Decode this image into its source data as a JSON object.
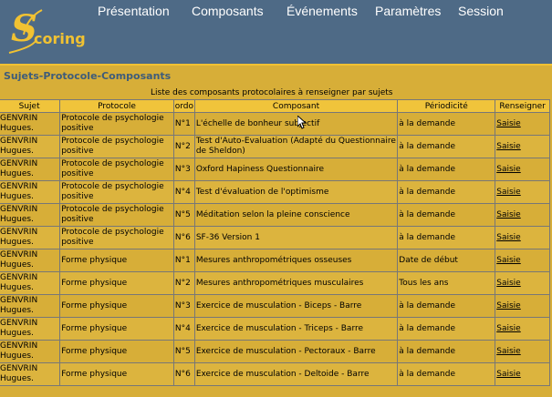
{
  "logo": {
    "initial": "S",
    "text": "coring"
  },
  "nav": [
    {
      "label": "Présentation"
    },
    {
      "label": "Composants"
    },
    {
      "label": "Événements"
    },
    {
      "label": "Paramètres"
    },
    {
      "label": "Session"
    }
  ],
  "page": {
    "title": "Sujets-Protocole-Composants",
    "caption": "Liste des composants protocolaires à renseigner par sujets"
  },
  "table": {
    "headers": [
      "Sujet",
      "Protocole",
      "ordo",
      "Composant",
      "Périodicité",
      "Renseigner"
    ],
    "rows": [
      {
        "sujet": "GENVRIN Hugues.",
        "protocole": "Protocole de psychologie positive",
        "ordo": "N°1",
        "composant": "L'échelle de bonheur subjectif",
        "periodicite": "à la demande",
        "action": "Saisie"
      },
      {
        "sujet": "GENVRIN Hugues.",
        "protocole": "Protocole de psychologie positive",
        "ordo": "N°2",
        "composant": "Test d'Auto-Evaluation (Adapté du Questionnaire de Sheldon)",
        "periodicite": "à la demande",
        "action": "Saisie"
      },
      {
        "sujet": "GENVRIN Hugues.",
        "protocole": "Protocole de psychologie positive",
        "ordo": "N°3",
        "composant": "Oxford Hapiness Questionnaire",
        "periodicite": "à la demande",
        "action": "Saisie"
      },
      {
        "sujet": "GENVRIN Hugues.",
        "protocole": "Protocole de psychologie positive",
        "ordo": "N°4",
        "composant": "Test d'évaluation de l'optimisme",
        "periodicite": "à la demande",
        "action": "Saisie"
      },
      {
        "sujet": "GENVRIN Hugues.",
        "protocole": "Protocole de psychologie positive",
        "ordo": "N°5",
        "composant": "Méditation selon la pleine conscience",
        "periodicite": "à la demande",
        "action": "Saisie"
      },
      {
        "sujet": "GENVRIN Hugues.",
        "protocole": "Protocole de psychologie positive",
        "ordo": "N°6",
        "composant": "SF-36 Version 1",
        "periodicite": "à la demande",
        "action": "Saisie"
      },
      {
        "sujet": "GENVRIN Hugues.",
        "protocole": "Forme physique",
        "ordo": "N°1",
        "composant": "Mesures anthropométriques osseuses",
        "periodicite": "Date de début",
        "action": "Saisie"
      },
      {
        "sujet": "GENVRIN Hugues.",
        "protocole": "Forme physique",
        "ordo": "N°2",
        "composant": "Mesures anthropométriques musculaires",
        "periodicite": "Tous les ans",
        "action": "Saisie"
      },
      {
        "sujet": "GENVRIN Hugues.",
        "protocole": "Forme physique",
        "ordo": "N°3",
        "composant": "Exercice de musculation - Biceps - Barre",
        "periodicite": "à la demande",
        "action": "Saisie"
      },
      {
        "sujet": "GENVRIN Hugues.",
        "protocole": "Forme physique",
        "ordo": "N°4",
        "composant": "Exercice de musculation - Triceps - Barre",
        "periodicite": "à la demande",
        "action": "Saisie"
      },
      {
        "sujet": "GENVRIN Hugues.",
        "protocole": "Forme physique",
        "ordo": "N°5",
        "composant": "Exercice de musculation - Pectoraux - Barre",
        "periodicite": "à la demande",
        "action": "Saisie"
      },
      {
        "sujet": "GENVRIN Hugues.",
        "protocole": "Forme physique",
        "ordo": "N°6",
        "composant": "Exercice de musculation - Deltoide - Barre",
        "periodicite": "à la demande",
        "action": "Saisie"
      }
    ]
  },
  "colors": {
    "header_bg": "#4e6a86",
    "accent": "#f1c232",
    "page_bg": "#d7ae38",
    "title": "#3e5c7a"
  }
}
